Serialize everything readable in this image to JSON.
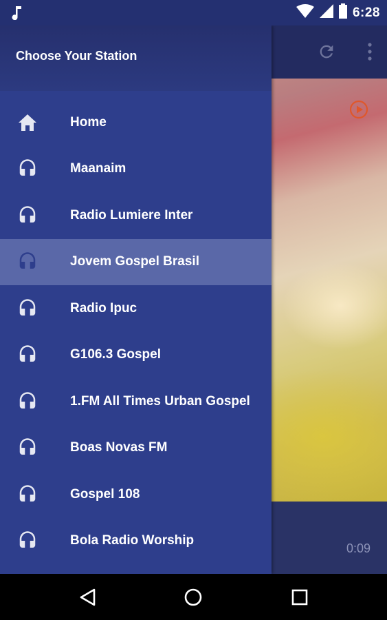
{
  "status_bar": {
    "time": "6:28",
    "icons": [
      "music-note-icon",
      "wifi-icon",
      "signal-icon",
      "battery-icon"
    ]
  },
  "drawer": {
    "title": "Choose Your Station",
    "items": [
      {
        "label": "Home",
        "icon": "home-icon",
        "selected": false
      },
      {
        "label": "Maanaim",
        "icon": "headphones-icon",
        "selected": false
      },
      {
        "label": "Radio Lumiere Inter",
        "icon": "headphones-icon",
        "selected": false
      },
      {
        "label": "Jovem Gospel Brasil",
        "icon": "headphones-icon",
        "selected": true
      },
      {
        "label": "Radio Ipuc",
        "icon": "headphones-icon",
        "selected": false
      },
      {
        "label": "G106.3 Gospel",
        "icon": "headphones-icon",
        "selected": false
      },
      {
        "label": "1.FM All Times Urban Gospel",
        "icon": "headphones-icon",
        "selected": false
      },
      {
        "label": "Boas Novas FM",
        "icon": "headphones-icon",
        "selected": false
      },
      {
        "label": "Gospel 108",
        "icon": "headphones-icon",
        "selected": false
      },
      {
        "label": "Bola Radio Worship",
        "icon": "headphones-icon",
        "selected": false
      }
    ]
  },
  "toolbar": {
    "actions": [
      "refresh-icon",
      "more-vert-icon"
    ]
  },
  "player": {
    "elapsed": "0:09",
    "play_icon": "play-circle-icon"
  },
  "nav_bar": {
    "buttons": [
      "back-icon",
      "home-circle-icon",
      "recents-icon"
    ]
  },
  "colors": {
    "drawer_bg": "#2e3e8c",
    "selected_bg": "#5a68a8",
    "status_bar": "#243071",
    "accent_play": "#e0572a"
  }
}
